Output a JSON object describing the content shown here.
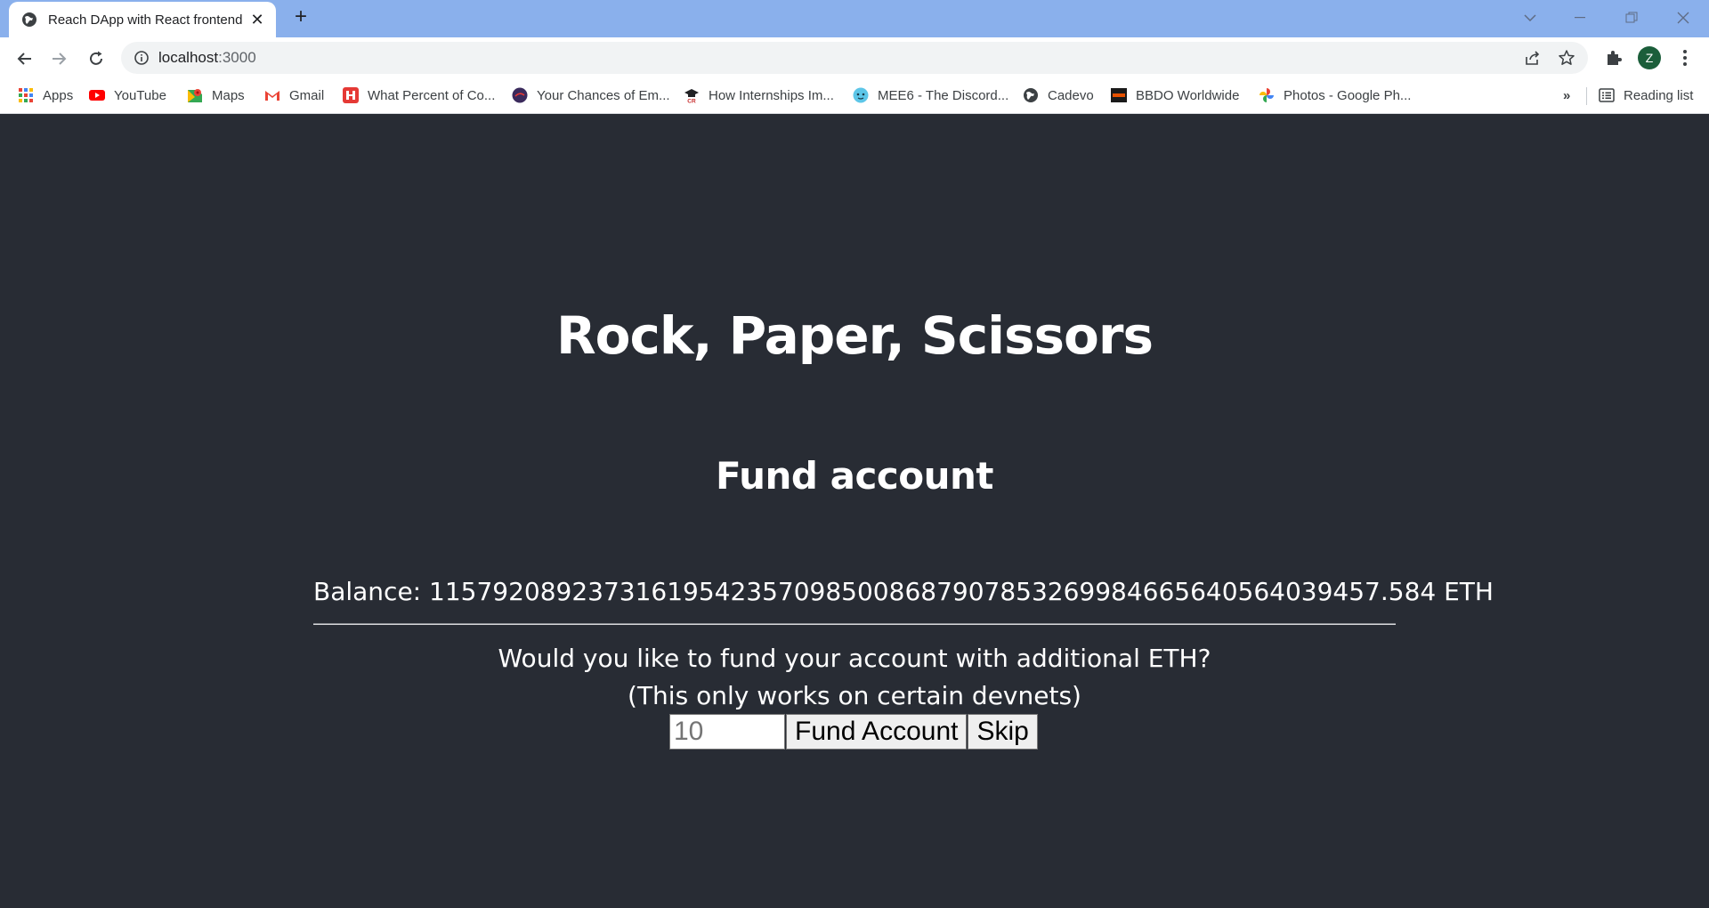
{
  "browser": {
    "tab_title": "Reach DApp with React frontend",
    "url_host": "localhost",
    "url_port": ":3000",
    "avatar_letter": "Z",
    "reading_list_label": "Reading list",
    "overflow_label": "»"
  },
  "bookmarks": [
    {
      "label": "Apps",
      "icon": "apps-grid-icon"
    },
    {
      "label": "YouTube",
      "icon": "youtube-icon"
    },
    {
      "label": "Maps",
      "icon": "maps-icon"
    },
    {
      "label": "Gmail",
      "icon": "gmail-icon"
    },
    {
      "label": "What Percent of Co...",
      "icon": "site-icon"
    },
    {
      "label": "Your Chances of Em...",
      "icon": "site-icon"
    },
    {
      "label": "How Internships Im...",
      "icon": "site-icon"
    },
    {
      "label": "MEE6 - The Discord...",
      "icon": "mee6-icon"
    },
    {
      "label": "Cadevo",
      "icon": "globe-icon"
    },
    {
      "label": "BBDO Worldwide",
      "icon": "site-icon"
    },
    {
      "label": "Photos - Google Ph...",
      "icon": "photos-icon"
    }
  ],
  "page": {
    "title": "Rock, Paper, Scissors",
    "subtitle": "Fund account",
    "balance": "Balance: 115792089237316195423570985008687907853269984665640564039457.584 ETH",
    "question": "Would you like to fund your account with additional ETH?",
    "note": "(This only works on certain devnets)",
    "amount_placeholder": "10",
    "fund_button": "Fund Account",
    "skip_button": "Skip"
  },
  "colors": {
    "page_background": "#282c34",
    "tabstrip": "#8ab0ec",
    "text": "#ffffff"
  }
}
